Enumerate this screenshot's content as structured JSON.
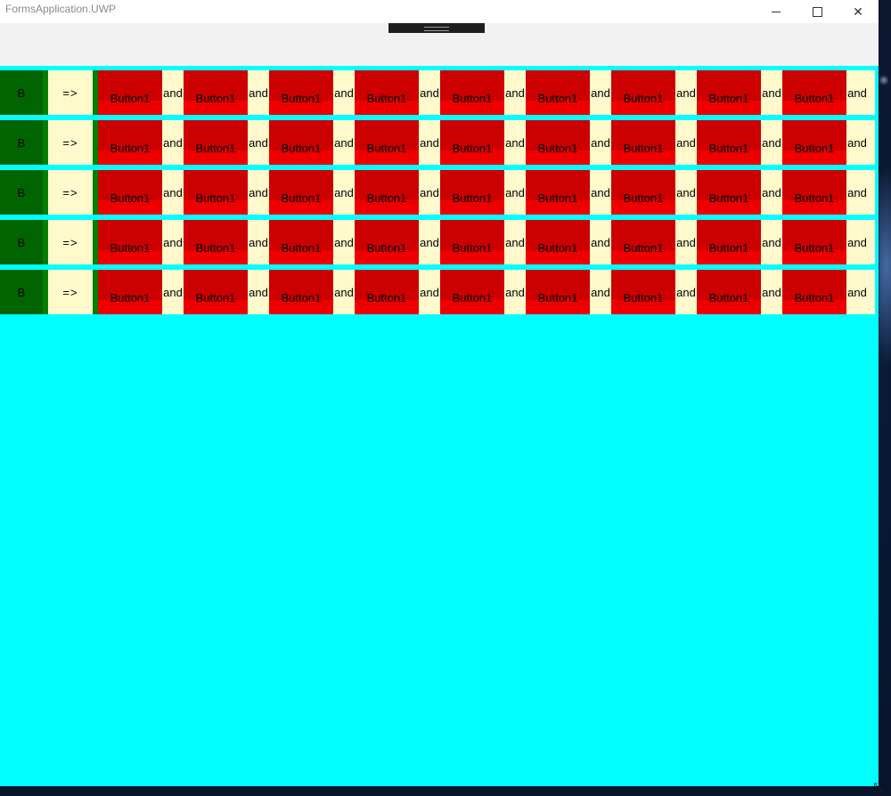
{
  "window": {
    "title": "FormsApplication.UWP",
    "minimize_icon": "minimize-icon",
    "maximize_icon": "maximize-icon",
    "close_icon": "close-icon",
    "close_glyph": "✕"
  },
  "colors": {
    "content_bg": "#00ffff",
    "label_green": "#006400",
    "separator_green": "#008000",
    "row_bg": "#fff9cc",
    "button_red": "#cc0000"
  },
  "rows": [
    {
      "label": "B",
      "arrow": "=>",
      "items": [
        "Button1",
        "and",
        "Button1",
        "and",
        "Button1",
        "and",
        "Button1",
        "and",
        "Button1",
        "and",
        "Button1",
        "and",
        "Button1",
        "and",
        "Button1",
        "and",
        "Button1",
        "and"
      ]
    },
    {
      "label": "B",
      "arrow": "=>",
      "items": [
        "Button1",
        "and",
        "Button1",
        "and",
        "Button1",
        "and",
        "Button1",
        "and",
        "Button1",
        "and",
        "Button1",
        "and",
        "Button1",
        "and",
        "Button1",
        "and",
        "Button1",
        "and"
      ]
    },
    {
      "label": "B",
      "arrow": "=>",
      "items": [
        "Button1",
        "and",
        "Button1",
        "and",
        "Button1",
        "and",
        "Button1",
        "and",
        "Button1",
        "and",
        "Button1",
        "and",
        "Button1",
        "and",
        "Button1",
        "and",
        "Button1",
        "and"
      ]
    },
    {
      "label": "B",
      "arrow": "=>",
      "items": [
        "Button1",
        "and",
        "Button1",
        "and",
        "Button1",
        "and",
        "Button1",
        "and",
        "Button1",
        "and",
        "Button1",
        "and",
        "Button1",
        "and",
        "Button1",
        "and",
        "Button1",
        "and"
      ]
    },
    {
      "label": "B",
      "arrow": "=>",
      "items": [
        "Button1",
        "and",
        "Button1",
        "and",
        "Button1",
        "and",
        "Button1",
        "and",
        "Button1",
        "and",
        "Button1",
        "and",
        "Button1",
        "and",
        "Button1",
        "and",
        "Button1",
        "and"
      ]
    }
  ],
  "resize_icon": "resize-grip-icon",
  "resize_glyph": "⤡"
}
